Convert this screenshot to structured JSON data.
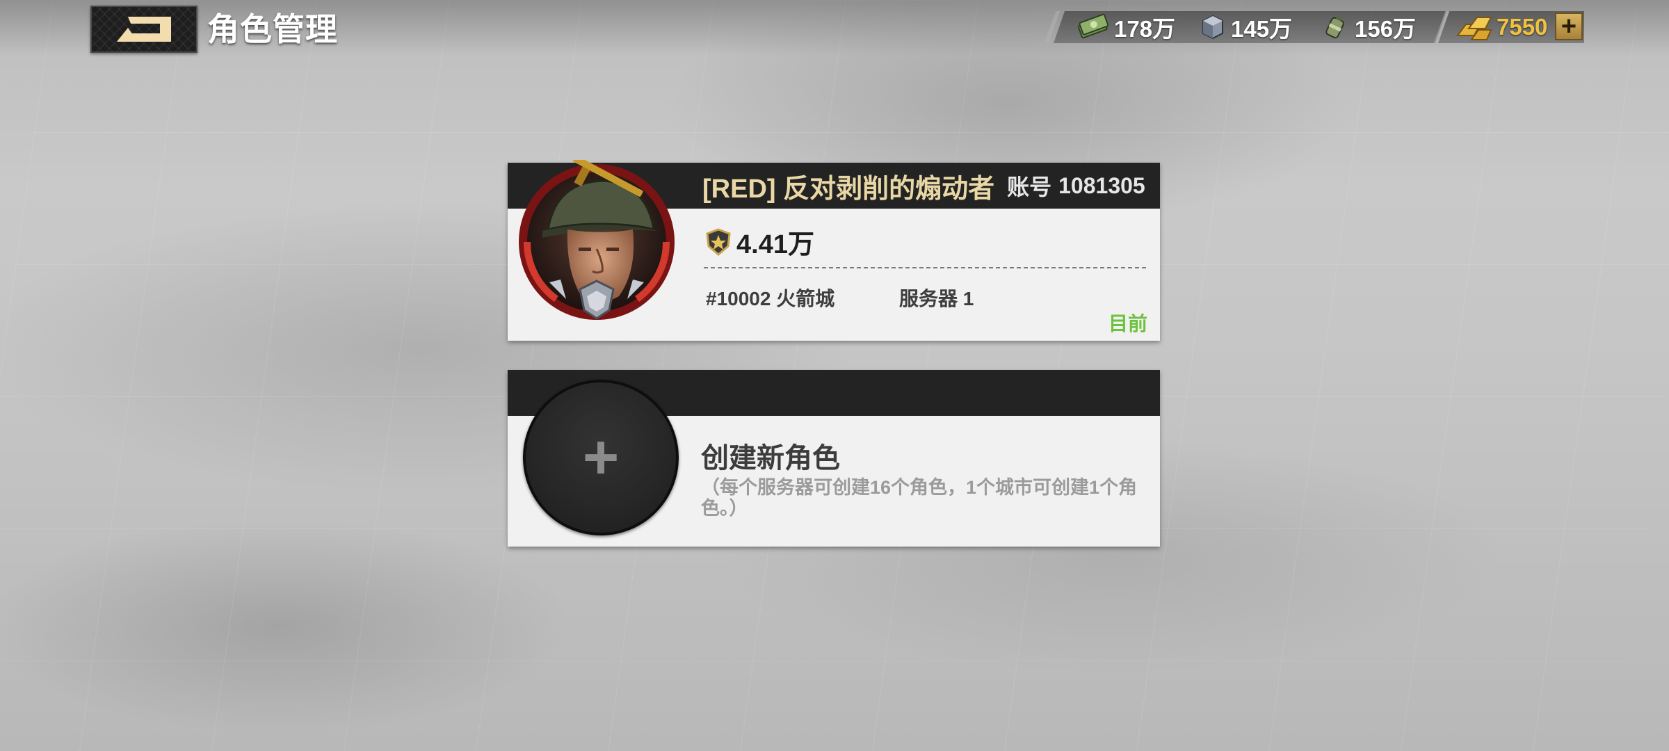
{
  "header": {
    "title": "角色管理"
  },
  "resources": [
    {
      "icon": "cash-icon",
      "value": "178万"
    },
    {
      "icon": "steel-icon",
      "value": "145万"
    },
    {
      "icon": "oil-icon",
      "value": "156万"
    }
  ],
  "gold": {
    "icon": "gold-bars-icon",
    "value": "7550"
  },
  "add_gold_symbol": "+",
  "character": {
    "name": "[RED] 反对剥削的煽动者",
    "account_label": "账号",
    "account_id": "1081305",
    "power": "4.41万",
    "city": "#10002 火箭城",
    "server": "服务器 1",
    "status": "目前",
    "status_color": "#6cc33b"
  },
  "create": {
    "plus_symbol": "+",
    "title": "创建新角色",
    "note": "（每个服务器可创建16个角色，1个城市可创建1个角色。）"
  }
}
